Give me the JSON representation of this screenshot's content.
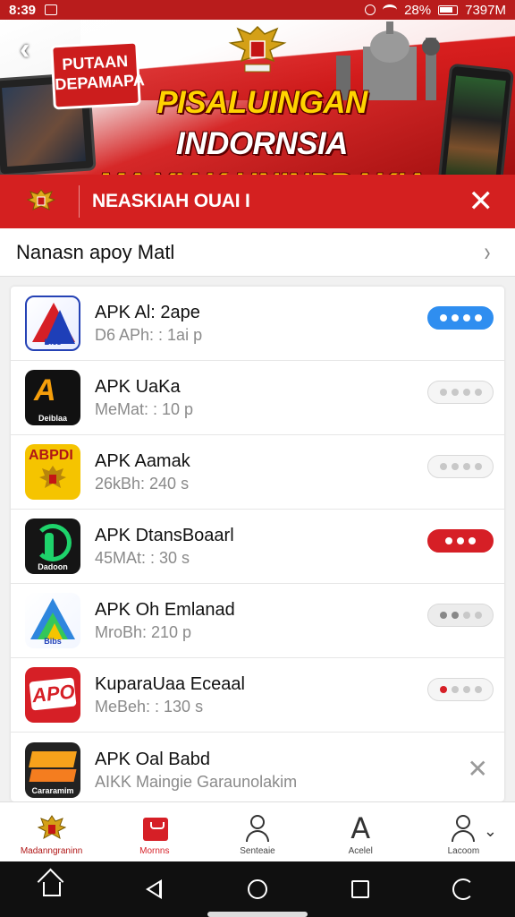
{
  "status_bar": {
    "time": "8:39",
    "battery_percent": "28%",
    "clock_right": "7397M"
  },
  "banner": {
    "tag_text": "PUTAAN DEPAMAPA",
    "headline_line1_part1": "PISALUINGAN",
    "headline_line1_part2": "INDORNSIA",
    "headline_line2": "MA YIAK UNINPRAKIA"
  },
  "section_header": {
    "title": "NEASKIAH OUAI I"
  },
  "subrow": {
    "title": "Nanasn apoy Matl"
  },
  "apps": [
    {
      "name": "APK Al: 2ape",
      "meta": "D6 APh: : 1ai p",
      "icon_caption": "Bies",
      "toggle": "blue"
    },
    {
      "name": "APK UaKa",
      "meta": "MeMat: : 10 p",
      "icon_caption": "Deiblaa",
      "toggle": "off"
    },
    {
      "name": "APK Aamak",
      "meta": "26kBh: 240 s",
      "icon_caption": "ABPDI",
      "toggle": "off"
    },
    {
      "name": "APK DtansBoaarl",
      "meta": "45MAt: : 30 s",
      "icon_caption": "Dadoon",
      "toggle": "red"
    },
    {
      "name": "APK Oh Emlanad",
      "meta": "MroBh: 210 p",
      "icon_caption": "Bibs",
      "toggle": "gray-partial"
    },
    {
      "name": "KuparaUaa Eceaal",
      "meta": "MeBeh: : 130 s",
      "icon_caption": "APOK",
      "toggle": "red-partial"
    },
    {
      "name": "APK Oal Babd",
      "meta": "AIKK Maingie Garaunolakim",
      "icon_caption": "Cararamim",
      "toggle": "close"
    }
  ],
  "tabs": [
    {
      "label": "Madanngraninn",
      "icon": "emblem-icon"
    },
    {
      "label": "Mornns",
      "icon": "tray-icon",
      "active": true
    },
    {
      "label": "Senteaie",
      "icon": "person-icon"
    },
    {
      "label": "Acelel",
      "icon": "letter-a-icon"
    },
    {
      "label": "Lacoom",
      "icon": "person-icon"
    }
  ],
  "colors": {
    "brand_red": "#d42020",
    "toggle_blue": "#2f8ef0",
    "toggle_red": "#d61f26"
  }
}
